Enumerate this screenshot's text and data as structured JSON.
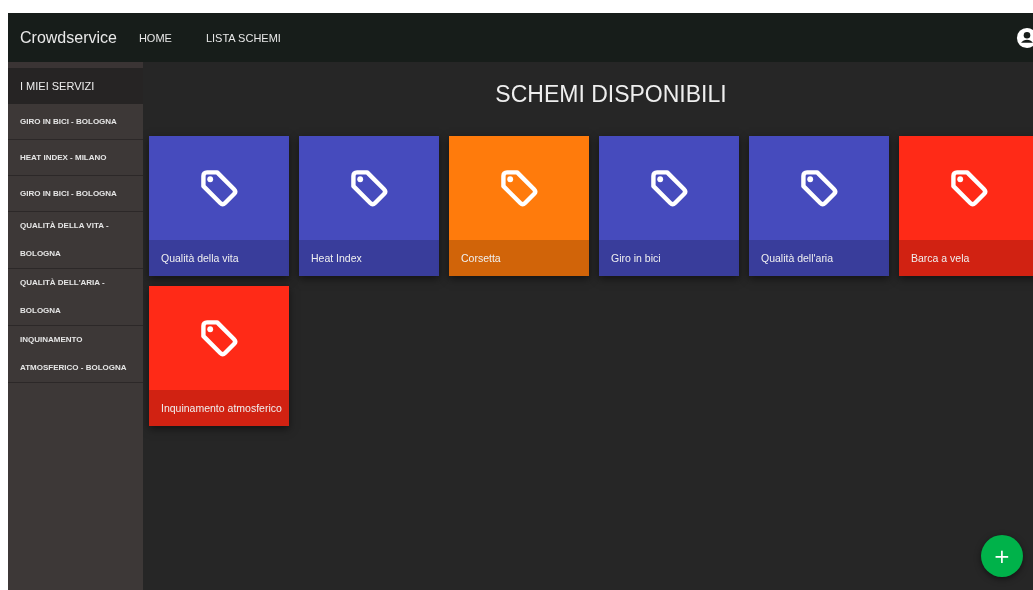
{
  "navbar": {
    "brand": "Crowdservice",
    "links": [
      "HOME",
      "LISTA SCHEMI"
    ]
  },
  "sidebar": {
    "title": "I MIEI SERVIZI",
    "items": [
      "GIRO IN BICI - BOLOGNA",
      "HEAT INDEX - MILANO",
      "GIRO IN BICI - BOLOGNA",
      "QUALITÀ DELLA VITA - BOLOGNA",
      "QUALITÀ DELL'ARIA - BOLOGNA",
      "INQUINAMENTO ATMOSFERICO - BOLOGNA"
    ]
  },
  "main": {
    "title": "SCHEMI DISPONIBILI",
    "cards": [
      {
        "label": "Qualità della vita",
        "color": "#464bbd"
      },
      {
        "label": "Heat Index",
        "color": "#464bbd"
      },
      {
        "label": "Corsetta",
        "color": "#ff7b0c"
      },
      {
        "label": "Giro in bici",
        "color": "#464bbd"
      },
      {
        "label": "Qualità dell'aria",
        "color": "#464bbd"
      },
      {
        "label": "Barca a vela",
        "color": "#ff2a17"
      },
      {
        "label": "Inquinamento atmosferico",
        "color": "#ff2a17"
      }
    ],
    "add_button": "+"
  }
}
